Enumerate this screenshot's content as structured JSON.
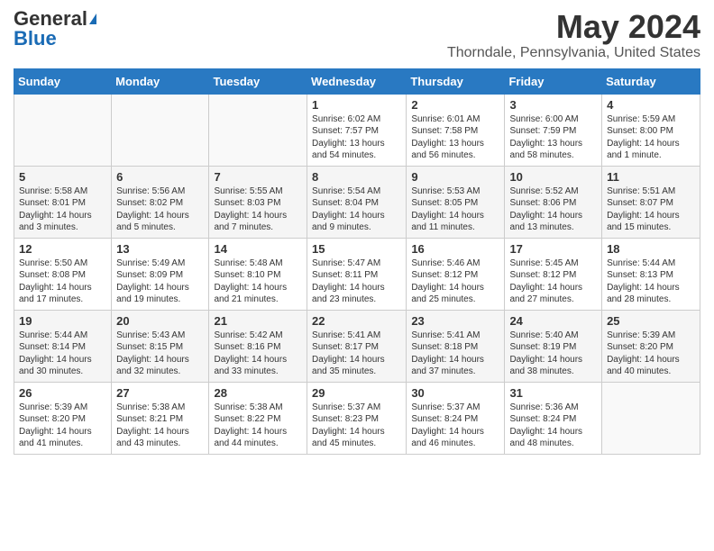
{
  "header": {
    "logo_general": "General",
    "logo_blue": "Blue",
    "month_title": "May 2024",
    "location": "Thorndale, Pennsylvania, United States"
  },
  "days_of_week": [
    "Sunday",
    "Monday",
    "Tuesday",
    "Wednesday",
    "Thursday",
    "Friday",
    "Saturday"
  ],
  "weeks": [
    [
      {
        "day": "",
        "info": ""
      },
      {
        "day": "",
        "info": ""
      },
      {
        "day": "",
        "info": ""
      },
      {
        "day": "1",
        "info": "Sunrise: 6:02 AM\nSunset: 7:57 PM\nDaylight: 13 hours and 54 minutes."
      },
      {
        "day": "2",
        "info": "Sunrise: 6:01 AM\nSunset: 7:58 PM\nDaylight: 13 hours and 56 minutes."
      },
      {
        "day": "3",
        "info": "Sunrise: 6:00 AM\nSunset: 7:59 PM\nDaylight: 13 hours and 58 minutes."
      },
      {
        "day": "4",
        "info": "Sunrise: 5:59 AM\nSunset: 8:00 PM\nDaylight: 14 hours and 1 minute."
      }
    ],
    [
      {
        "day": "5",
        "info": "Sunrise: 5:58 AM\nSunset: 8:01 PM\nDaylight: 14 hours and 3 minutes."
      },
      {
        "day": "6",
        "info": "Sunrise: 5:56 AM\nSunset: 8:02 PM\nDaylight: 14 hours and 5 minutes."
      },
      {
        "day": "7",
        "info": "Sunrise: 5:55 AM\nSunset: 8:03 PM\nDaylight: 14 hours and 7 minutes."
      },
      {
        "day": "8",
        "info": "Sunrise: 5:54 AM\nSunset: 8:04 PM\nDaylight: 14 hours and 9 minutes."
      },
      {
        "day": "9",
        "info": "Sunrise: 5:53 AM\nSunset: 8:05 PM\nDaylight: 14 hours and 11 minutes."
      },
      {
        "day": "10",
        "info": "Sunrise: 5:52 AM\nSunset: 8:06 PM\nDaylight: 14 hours and 13 minutes."
      },
      {
        "day": "11",
        "info": "Sunrise: 5:51 AM\nSunset: 8:07 PM\nDaylight: 14 hours and 15 minutes."
      }
    ],
    [
      {
        "day": "12",
        "info": "Sunrise: 5:50 AM\nSunset: 8:08 PM\nDaylight: 14 hours and 17 minutes."
      },
      {
        "day": "13",
        "info": "Sunrise: 5:49 AM\nSunset: 8:09 PM\nDaylight: 14 hours and 19 minutes."
      },
      {
        "day": "14",
        "info": "Sunrise: 5:48 AM\nSunset: 8:10 PM\nDaylight: 14 hours and 21 minutes."
      },
      {
        "day": "15",
        "info": "Sunrise: 5:47 AM\nSunset: 8:11 PM\nDaylight: 14 hours and 23 minutes."
      },
      {
        "day": "16",
        "info": "Sunrise: 5:46 AM\nSunset: 8:12 PM\nDaylight: 14 hours and 25 minutes."
      },
      {
        "day": "17",
        "info": "Sunrise: 5:45 AM\nSunset: 8:12 PM\nDaylight: 14 hours and 27 minutes."
      },
      {
        "day": "18",
        "info": "Sunrise: 5:44 AM\nSunset: 8:13 PM\nDaylight: 14 hours and 28 minutes."
      }
    ],
    [
      {
        "day": "19",
        "info": "Sunrise: 5:44 AM\nSunset: 8:14 PM\nDaylight: 14 hours and 30 minutes."
      },
      {
        "day": "20",
        "info": "Sunrise: 5:43 AM\nSunset: 8:15 PM\nDaylight: 14 hours and 32 minutes."
      },
      {
        "day": "21",
        "info": "Sunrise: 5:42 AM\nSunset: 8:16 PM\nDaylight: 14 hours and 33 minutes."
      },
      {
        "day": "22",
        "info": "Sunrise: 5:41 AM\nSunset: 8:17 PM\nDaylight: 14 hours and 35 minutes."
      },
      {
        "day": "23",
        "info": "Sunrise: 5:41 AM\nSunset: 8:18 PM\nDaylight: 14 hours and 37 minutes."
      },
      {
        "day": "24",
        "info": "Sunrise: 5:40 AM\nSunset: 8:19 PM\nDaylight: 14 hours and 38 minutes."
      },
      {
        "day": "25",
        "info": "Sunrise: 5:39 AM\nSunset: 8:20 PM\nDaylight: 14 hours and 40 minutes."
      }
    ],
    [
      {
        "day": "26",
        "info": "Sunrise: 5:39 AM\nSunset: 8:20 PM\nDaylight: 14 hours and 41 minutes."
      },
      {
        "day": "27",
        "info": "Sunrise: 5:38 AM\nSunset: 8:21 PM\nDaylight: 14 hours and 43 minutes."
      },
      {
        "day": "28",
        "info": "Sunrise: 5:38 AM\nSunset: 8:22 PM\nDaylight: 14 hours and 44 minutes."
      },
      {
        "day": "29",
        "info": "Sunrise: 5:37 AM\nSunset: 8:23 PM\nDaylight: 14 hours and 45 minutes."
      },
      {
        "day": "30",
        "info": "Sunrise: 5:37 AM\nSunset: 8:24 PM\nDaylight: 14 hours and 46 minutes."
      },
      {
        "day": "31",
        "info": "Sunrise: 5:36 AM\nSunset: 8:24 PM\nDaylight: 14 hours and 48 minutes."
      },
      {
        "day": "",
        "info": ""
      }
    ]
  ]
}
